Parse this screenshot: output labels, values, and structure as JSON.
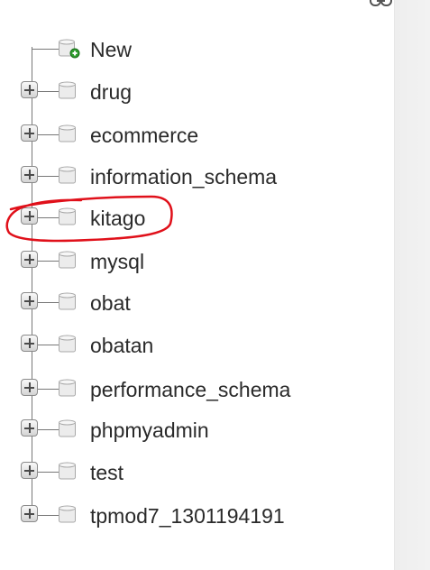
{
  "tree": {
    "new_label": "New",
    "databases": [
      {
        "label": "drug"
      },
      {
        "label": "ecommerce"
      },
      {
        "label": "information_schema"
      },
      {
        "label": "kitago"
      },
      {
        "label": "mysql"
      },
      {
        "label": "obat"
      },
      {
        "label": "obatan"
      },
      {
        "label": "performance_schema"
      },
      {
        "label": "phpmyadmin"
      },
      {
        "label": "test"
      },
      {
        "label": "tpmod7_1301194191"
      }
    ]
  },
  "colors": {
    "text": "#2a2a2a",
    "tree_line": "#777777",
    "annotation": "#e0101a",
    "new_badge": "#2e9d2e"
  }
}
